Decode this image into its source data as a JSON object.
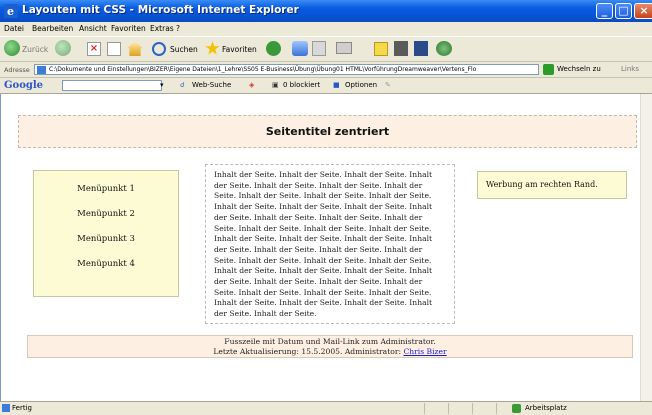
{
  "window": {
    "title": "Layouten mit CSS - Microsoft Internet Explorer",
    "min_glyph": "_",
    "max_glyph": "□",
    "close_glyph": "×"
  },
  "menubar": {
    "items": [
      "Datei",
      "Bearbeiten",
      "Ansicht",
      "Favoriten",
      "Extras",
      "?"
    ]
  },
  "toolbar": {
    "back_label": "Zurück",
    "search_label": "Suchen",
    "favorites_label": "Favoriten"
  },
  "address": {
    "label": "Adresse",
    "value": "C:\\Dokumente und Einstellungen\\BIZER\\Eigene Dateien\\1_Lehre\\SS05 E-Business\\Übung\\Übung01 HTML\\VorführungDreamweaver\\Vertens_Flo",
    "go_label": "Wechseln zu",
    "links_label": "Links"
  },
  "googlebar": {
    "logo": "Google",
    "search_button": "Web-Suche",
    "blocked_label": "0 blockiert",
    "options_label": "Optionen"
  },
  "page": {
    "title": "Seitentitel zentriert",
    "menu_items": [
      "Menüpunkt 1",
      "Menüpunkt 2",
      "Menüpunkt 3",
      "Menüpunkt 4"
    ],
    "content_text": "Inhalt der Seite. Inhalt der Seite. Inhalt der Seite. Inhalt der Seite. Inhalt der Seite. Inhalt der Seite. Inhalt der Seite. Inhalt der Seite. Inhalt der Seite. Inhalt der Seite. Inhalt der Seite. Inhalt der Seite. Inhalt der Seite. Inhalt der Seite. Inhalt der Seite. Inhalt der Seite. Inhalt der Seite. Inhalt der Seite. Inhalt der Seite. Inhalt der Seite. Inhalt der Seite. Inhalt der Seite. Inhalt der Seite. Inhalt der Seite. Inhalt der Seite. Inhalt der Seite. Inhalt der Seite. Inhalt der Seite. Inhalt der Seite. Inhalt der Seite. Inhalt der Seite. Inhalt der Seite. Inhalt der Seite. Inhalt der Seite. Inhalt der Seite. Inhalt der Seite. Inhalt der Seite. Inhalt der Seite. Inhalt der Seite. Inhalt der Seite. Inhalt der Seite. Inhalt der Seite. Inhalt der Seite. Inhalt der Seite. Inhalt der Seite.",
    "ad_text": "Werbung am rechten Rand.",
    "footer_line1": "Fusszeile mit Datum und Mail-Link zum Administrator.",
    "footer_line2_prefix": "Letzte Aktualisierung: 15.5.2005. Administrator: ",
    "footer_admin_link": "Chris Bizer"
  },
  "status": {
    "ready": "Fertig",
    "zone": "Arbeitsplatz"
  },
  "colors": {
    "titlebar": "#0653d6",
    "page_title_bg": "#fdf0e3",
    "sidebox_bg": "#fdfbd4",
    "link": "#1a1ad0"
  }
}
